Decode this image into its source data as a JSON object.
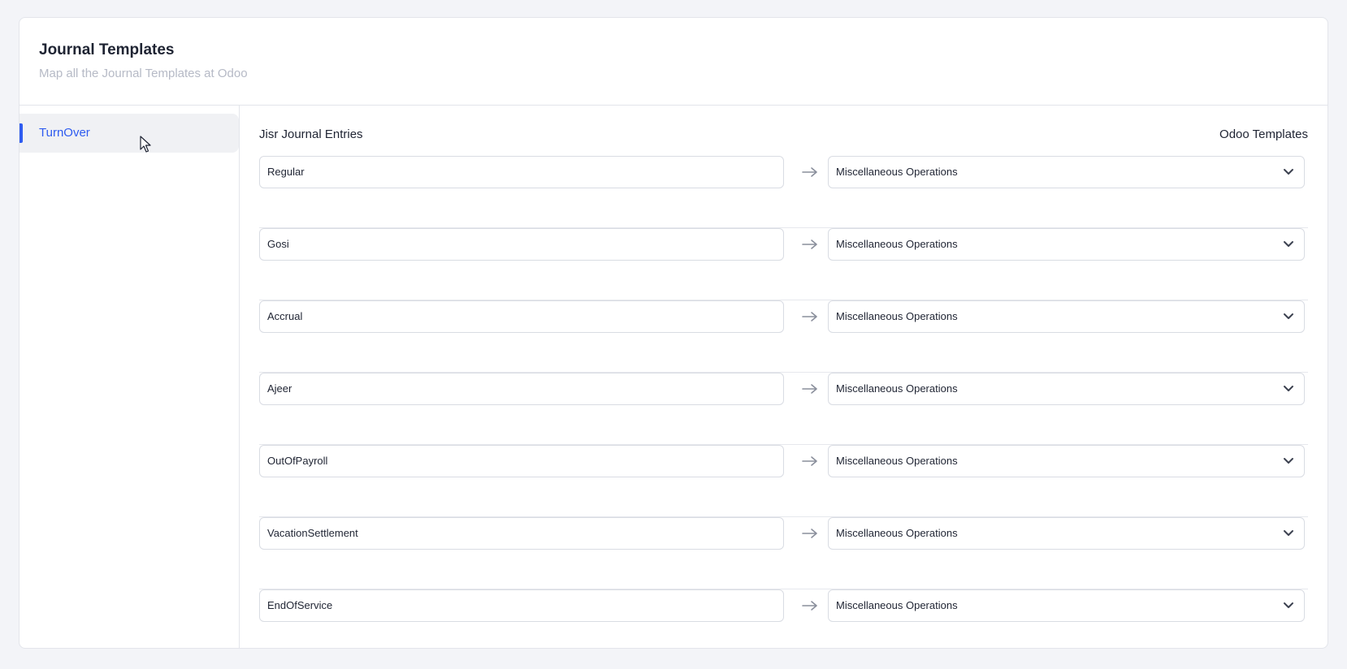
{
  "header": {
    "title": "Journal Templates",
    "subtitle": "Map all the Journal Templates at Odoo"
  },
  "sidebar": {
    "items": [
      {
        "label": "TurnOver",
        "active": true
      }
    ]
  },
  "columns": {
    "left": "Jisr Journal Entries",
    "right": "Odoo Templates"
  },
  "mappings": [
    {
      "source": "Regular",
      "template": "Miscellaneous Operations"
    },
    {
      "source": "Gosi",
      "template": "Miscellaneous Operations"
    },
    {
      "source": "Accrual",
      "template": "Miscellaneous Operations"
    },
    {
      "source": "Ajeer",
      "template": "Miscellaneous Operations"
    },
    {
      "source": "OutOfPayroll",
      "template": "Miscellaneous Operations"
    },
    {
      "source": "VacationSettlement",
      "template": "Miscellaneous Operations"
    },
    {
      "source": "EndOfService",
      "template": "Miscellaneous Operations"
    }
  ],
  "icons": {
    "row_arrow": "arrow-right-icon",
    "select_toggle": "chevron-down-icon"
  },
  "colors": {
    "accent": "#2f5cf0",
    "subtitle": "#b6bac6",
    "border": "#d9dce3"
  }
}
